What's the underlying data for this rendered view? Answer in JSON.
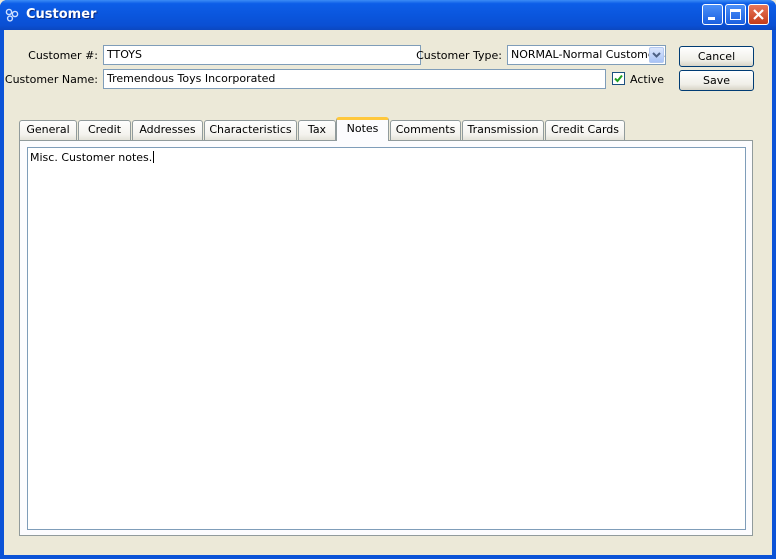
{
  "window": {
    "title": "Customer",
    "icon": "xtuple-icon"
  },
  "form": {
    "customer_number_label": "Customer #:",
    "customer_number_value": "TTOYS",
    "customer_type_label": "Customer Type:",
    "customer_type_value": "NORMAL-Normal Customers",
    "customer_name_label": "Customer Name:",
    "customer_name_value": "Tremendous Toys Incorporated",
    "active_label": "Active",
    "active_checked": true
  },
  "buttons": {
    "cancel": "Cancel",
    "save": "Save"
  },
  "tabs": [
    {
      "label": "General"
    },
    {
      "label": "Credit"
    },
    {
      "label": "Addresses"
    },
    {
      "label": "Characteristics"
    },
    {
      "label": "Tax"
    },
    {
      "label": "Notes"
    },
    {
      "label": "Comments"
    },
    {
      "label": "Transmission"
    },
    {
      "label": "Credit Cards"
    }
  ],
  "active_tab": "Notes",
  "notes": {
    "text": "Misc. Customer notes."
  }
}
